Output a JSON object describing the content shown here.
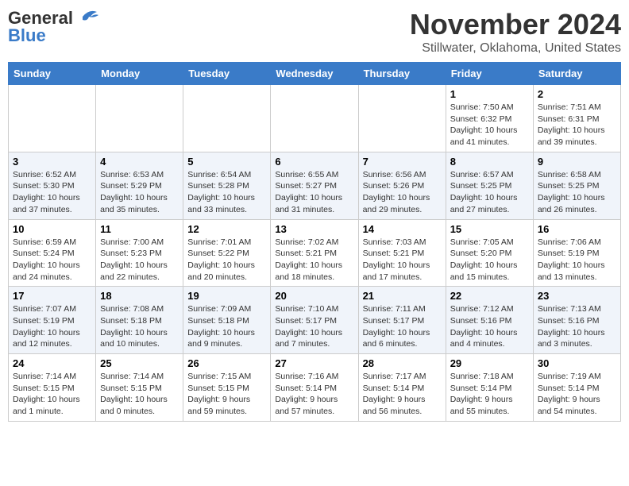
{
  "header": {
    "logo_line1": "General",
    "logo_line2": "Blue",
    "month": "November 2024",
    "location": "Stillwater, Oklahoma, United States"
  },
  "weekdays": [
    "Sunday",
    "Monday",
    "Tuesday",
    "Wednesday",
    "Thursday",
    "Friday",
    "Saturday"
  ],
  "weeks": [
    [
      {
        "day": "",
        "info": ""
      },
      {
        "day": "",
        "info": ""
      },
      {
        "day": "",
        "info": ""
      },
      {
        "day": "",
        "info": ""
      },
      {
        "day": "",
        "info": ""
      },
      {
        "day": "1",
        "info": "Sunrise: 7:50 AM\nSunset: 6:32 PM\nDaylight: 10 hours\nand 41 minutes."
      },
      {
        "day": "2",
        "info": "Sunrise: 7:51 AM\nSunset: 6:31 PM\nDaylight: 10 hours\nand 39 minutes."
      }
    ],
    [
      {
        "day": "3",
        "info": "Sunrise: 6:52 AM\nSunset: 5:30 PM\nDaylight: 10 hours\nand 37 minutes."
      },
      {
        "day": "4",
        "info": "Sunrise: 6:53 AM\nSunset: 5:29 PM\nDaylight: 10 hours\nand 35 minutes."
      },
      {
        "day": "5",
        "info": "Sunrise: 6:54 AM\nSunset: 5:28 PM\nDaylight: 10 hours\nand 33 minutes."
      },
      {
        "day": "6",
        "info": "Sunrise: 6:55 AM\nSunset: 5:27 PM\nDaylight: 10 hours\nand 31 minutes."
      },
      {
        "day": "7",
        "info": "Sunrise: 6:56 AM\nSunset: 5:26 PM\nDaylight: 10 hours\nand 29 minutes."
      },
      {
        "day": "8",
        "info": "Sunrise: 6:57 AM\nSunset: 5:25 PM\nDaylight: 10 hours\nand 27 minutes."
      },
      {
        "day": "9",
        "info": "Sunrise: 6:58 AM\nSunset: 5:25 PM\nDaylight: 10 hours\nand 26 minutes."
      }
    ],
    [
      {
        "day": "10",
        "info": "Sunrise: 6:59 AM\nSunset: 5:24 PM\nDaylight: 10 hours\nand 24 minutes."
      },
      {
        "day": "11",
        "info": "Sunrise: 7:00 AM\nSunset: 5:23 PM\nDaylight: 10 hours\nand 22 minutes."
      },
      {
        "day": "12",
        "info": "Sunrise: 7:01 AM\nSunset: 5:22 PM\nDaylight: 10 hours\nand 20 minutes."
      },
      {
        "day": "13",
        "info": "Sunrise: 7:02 AM\nSunset: 5:21 PM\nDaylight: 10 hours\nand 18 minutes."
      },
      {
        "day": "14",
        "info": "Sunrise: 7:03 AM\nSunset: 5:21 PM\nDaylight: 10 hours\nand 17 minutes."
      },
      {
        "day": "15",
        "info": "Sunrise: 7:05 AM\nSunset: 5:20 PM\nDaylight: 10 hours\nand 15 minutes."
      },
      {
        "day": "16",
        "info": "Sunrise: 7:06 AM\nSunset: 5:19 PM\nDaylight: 10 hours\nand 13 minutes."
      }
    ],
    [
      {
        "day": "17",
        "info": "Sunrise: 7:07 AM\nSunset: 5:19 PM\nDaylight: 10 hours\nand 12 minutes."
      },
      {
        "day": "18",
        "info": "Sunrise: 7:08 AM\nSunset: 5:18 PM\nDaylight: 10 hours\nand 10 minutes."
      },
      {
        "day": "19",
        "info": "Sunrise: 7:09 AM\nSunset: 5:18 PM\nDaylight: 10 hours\nand 9 minutes."
      },
      {
        "day": "20",
        "info": "Sunrise: 7:10 AM\nSunset: 5:17 PM\nDaylight: 10 hours\nand 7 minutes."
      },
      {
        "day": "21",
        "info": "Sunrise: 7:11 AM\nSunset: 5:17 PM\nDaylight: 10 hours\nand 6 minutes."
      },
      {
        "day": "22",
        "info": "Sunrise: 7:12 AM\nSunset: 5:16 PM\nDaylight: 10 hours\nand 4 minutes."
      },
      {
        "day": "23",
        "info": "Sunrise: 7:13 AM\nSunset: 5:16 PM\nDaylight: 10 hours\nand 3 minutes."
      }
    ],
    [
      {
        "day": "24",
        "info": "Sunrise: 7:14 AM\nSunset: 5:15 PM\nDaylight: 10 hours\nand 1 minute."
      },
      {
        "day": "25",
        "info": "Sunrise: 7:14 AM\nSunset: 5:15 PM\nDaylight: 10 hours\nand 0 minutes."
      },
      {
        "day": "26",
        "info": "Sunrise: 7:15 AM\nSunset: 5:15 PM\nDaylight: 9 hours\nand 59 minutes."
      },
      {
        "day": "27",
        "info": "Sunrise: 7:16 AM\nSunset: 5:14 PM\nDaylight: 9 hours\nand 57 minutes."
      },
      {
        "day": "28",
        "info": "Sunrise: 7:17 AM\nSunset: 5:14 PM\nDaylight: 9 hours\nand 56 minutes."
      },
      {
        "day": "29",
        "info": "Sunrise: 7:18 AM\nSunset: 5:14 PM\nDaylight: 9 hours\nand 55 minutes."
      },
      {
        "day": "30",
        "info": "Sunrise: 7:19 AM\nSunset: 5:14 PM\nDaylight: 9 hours\nand 54 minutes."
      }
    ]
  ]
}
